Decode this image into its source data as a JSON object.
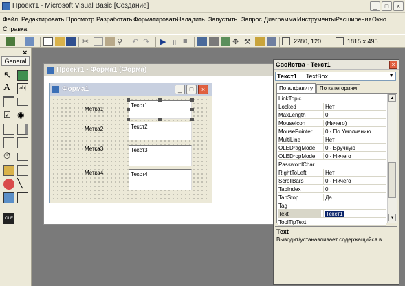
{
  "window": {
    "title": "Проект1 - Microsoft Visual Basic [Создание]"
  },
  "menu": [
    "Файл",
    "Редактировать",
    "Просмотр",
    "Разработать",
    "Форматировать",
    "Наладить",
    "Запустить",
    "Запрос",
    "Диаграмма",
    "Инструменты",
    "Расширения",
    "Окно",
    "Справка"
  ],
  "toolbar": {
    "position": "2280, 120",
    "size": "1815 x 495"
  },
  "toolbox": {
    "tab": "General",
    "close": "×"
  },
  "designer": {
    "title": "Проект1 - Форма1 (Форма)",
    "form_title": "Форма1",
    "labels": [
      "Метка1",
      "Метка2",
      "Метка3",
      "Метка4"
    ],
    "textboxes": [
      "Текст1",
      "Текст2",
      "Текст3",
      "Текст4"
    ]
  },
  "properties": {
    "title": "Свойства - Текст1",
    "object_name": "Текст1",
    "object_type": "TextBox",
    "tab_alpha": "По алфавиту",
    "tab_category": "По категориям",
    "rows": [
      {
        "name": "LinkTopic",
        "value": ""
      },
      {
        "name": "Locked",
        "value": "Нет"
      },
      {
        "name": "MaxLength",
        "value": "0"
      },
      {
        "name": "MouseIcon",
        "value": "(Ничего)"
      },
      {
        "name": "MousePointer",
        "value": "0 - По Умолчанию"
      },
      {
        "name": "MultiLine",
        "value": "Нет"
      },
      {
        "name": "OLEDragMode",
        "value": "0 - Вручную"
      },
      {
        "name": "OLEDropMode",
        "value": "0 - Ничего"
      },
      {
        "name": "PasswordChar",
        "value": ""
      },
      {
        "name": "RightToLeft",
        "value": "Нет"
      },
      {
        "name": "ScrollBars",
        "value": "0 - Ничего"
      },
      {
        "name": "TabIndex",
        "value": "0"
      },
      {
        "name": "TabStop",
        "value": "Да"
      },
      {
        "name": "Tag",
        "value": ""
      },
      {
        "name": "Text",
        "value": "Текст1"
      },
      {
        "name": "ToolTipText",
        "value": ""
      }
    ],
    "desc_title": "Text",
    "desc_text": "Выводит/устанавливает содержащийся в"
  }
}
